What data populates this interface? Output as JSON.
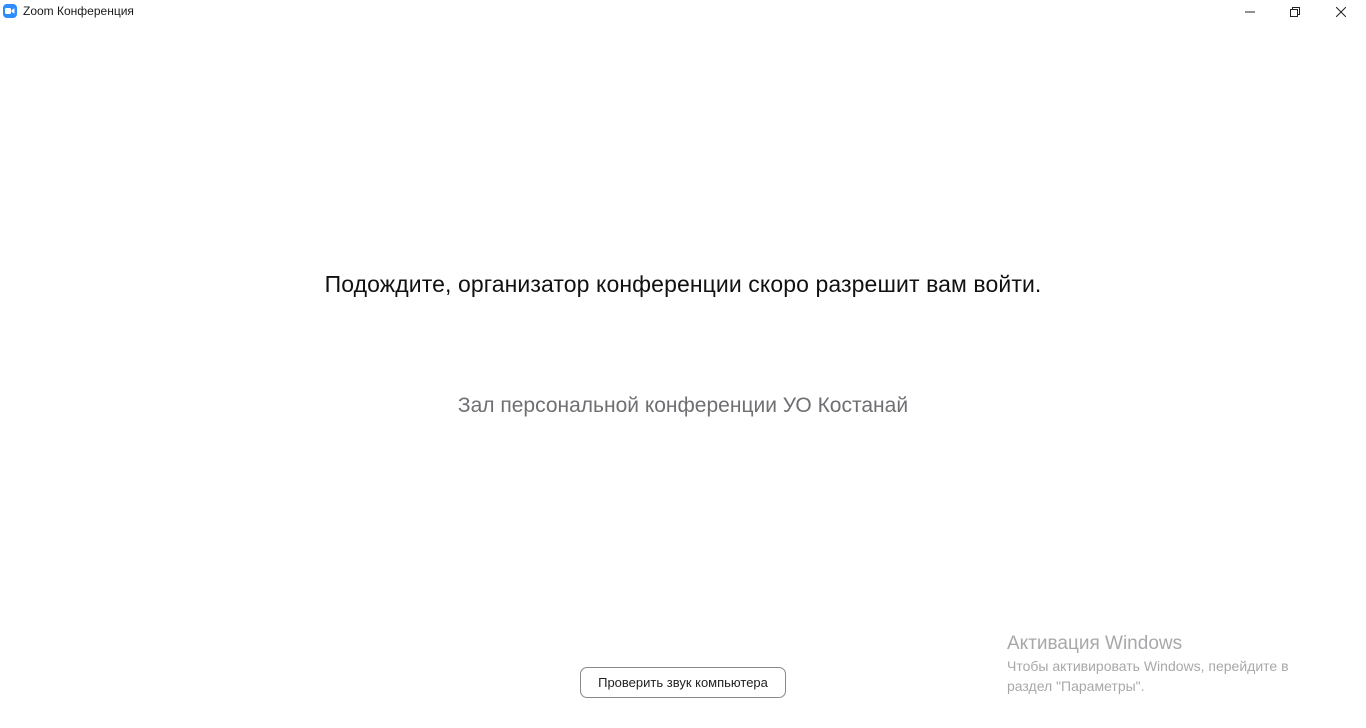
{
  "window": {
    "title": "Zoom Конференция",
    "app_icon": "zoom-camera-icon",
    "controls": {
      "minimize": "minimize-icon",
      "maximize": "restore-icon",
      "close": "close-icon"
    }
  },
  "main": {
    "waiting_message": "Подождите, организатор конференции скоро разрешит вам войти.",
    "room_name": "Зал персональной конференции УО Костанай",
    "test_audio_button": "Проверить звук компьютера"
  },
  "watermark": {
    "title": "Активация Windows",
    "line1": "Чтобы активировать Windows, перейдите в",
    "line2": "раздел \"Параметры\"."
  },
  "colors": {
    "accent": "#2d8cff",
    "text_primary": "#111111",
    "text_secondary": "#6f6f73",
    "watermark": "#a8a8ab"
  }
}
